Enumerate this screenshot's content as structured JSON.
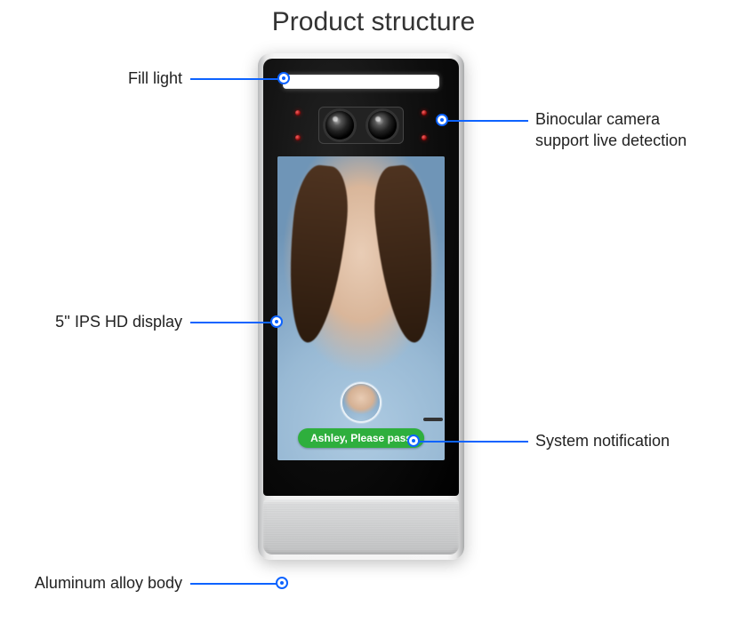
{
  "title": "Product structure",
  "callouts": {
    "fill_light": "Fill light",
    "camera_l1": "Binocular camera",
    "camera_l2": "support live detection",
    "display": "5'' IPS HD display",
    "notification_label": "System notification",
    "body": "Aluminum alloy body"
  },
  "screen": {
    "notification_text": "Ashley,   Please pass",
    "subject_name": "Ashley"
  },
  "colors": {
    "leader": "#0d63ff",
    "notify_bg": "#2eaf3d"
  }
}
